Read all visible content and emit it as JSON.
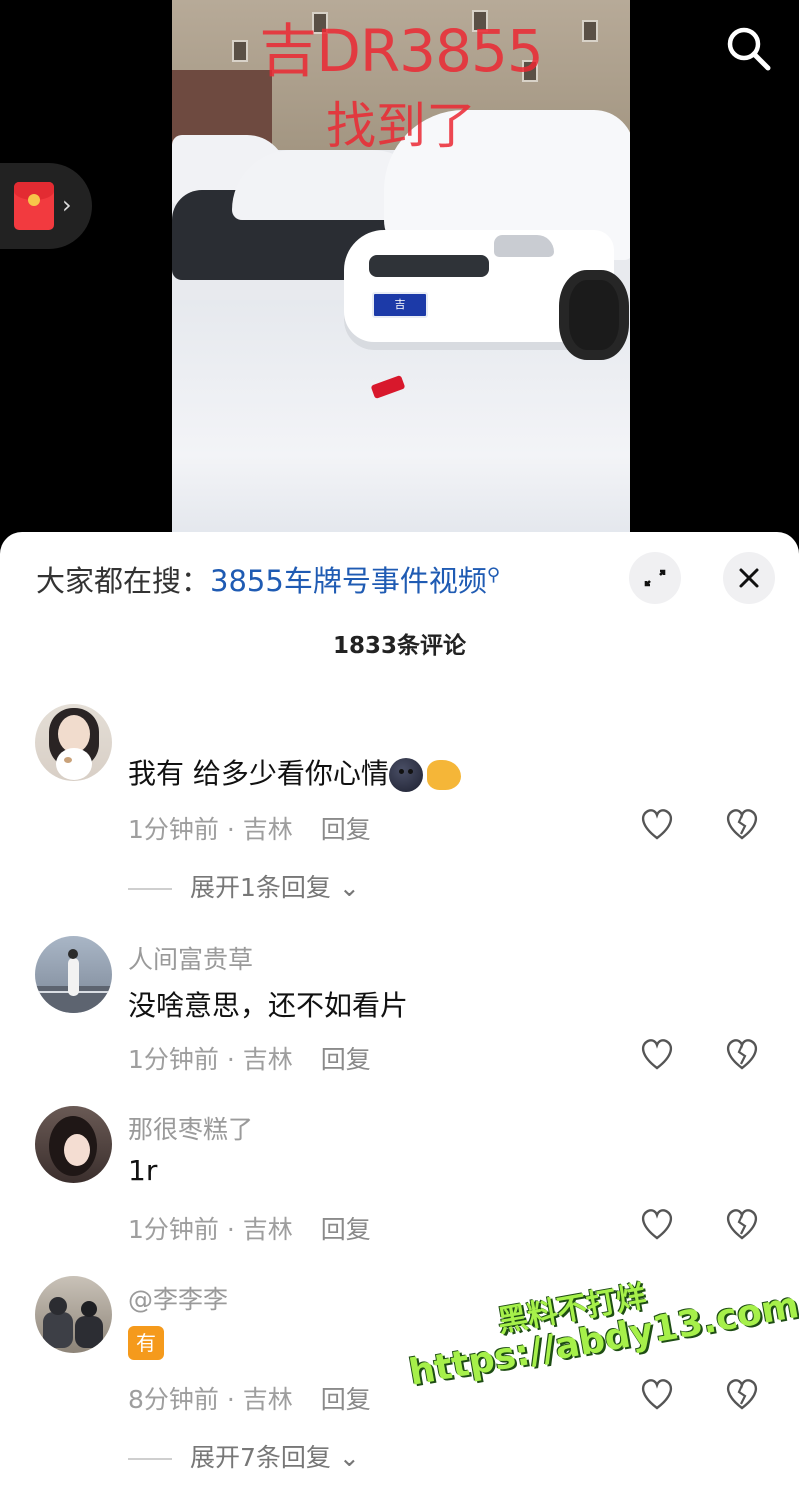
{
  "video": {
    "overlay_line1": "吉DR3855",
    "overlay_line2": "找到了",
    "plate_text": "吉DR3855"
  },
  "search_icon": "search-icon",
  "redpacket_icon": "red-envelope-icon",
  "sheet": {
    "hot_search_prefix": "大家都在搜：",
    "hot_search_link": "3855车牌号事件视频",
    "comment_count": "1833条评论"
  },
  "comments": [
    {
      "username": "",
      "text": "我有 给多少看你心情",
      "time": "1分钟前",
      "location": "吉林",
      "reply": "回复",
      "expand": "展开1条回复"
    },
    {
      "username": "人间富贵草",
      "text": "没啥意思，还不如看片",
      "time": "1分钟前",
      "location": "吉林",
      "reply": "回复"
    },
    {
      "username": "那很枣糕了",
      "text": "1r",
      "time": "1分钟前",
      "location": "吉林",
      "reply": "回复"
    },
    {
      "username": "@李李李",
      "badge": "有",
      "time": "8分钟前",
      "location": "吉林",
      "reply": "回复",
      "expand": "展开7条回复"
    }
  ],
  "watermark": {
    "line1": "黑料不打烊",
    "line2": "https://abdy13.com"
  },
  "colors": {
    "link": "#1f5bb3",
    "meta_gray": "#9e9e9e",
    "watermark_green": "#a6f04a"
  }
}
